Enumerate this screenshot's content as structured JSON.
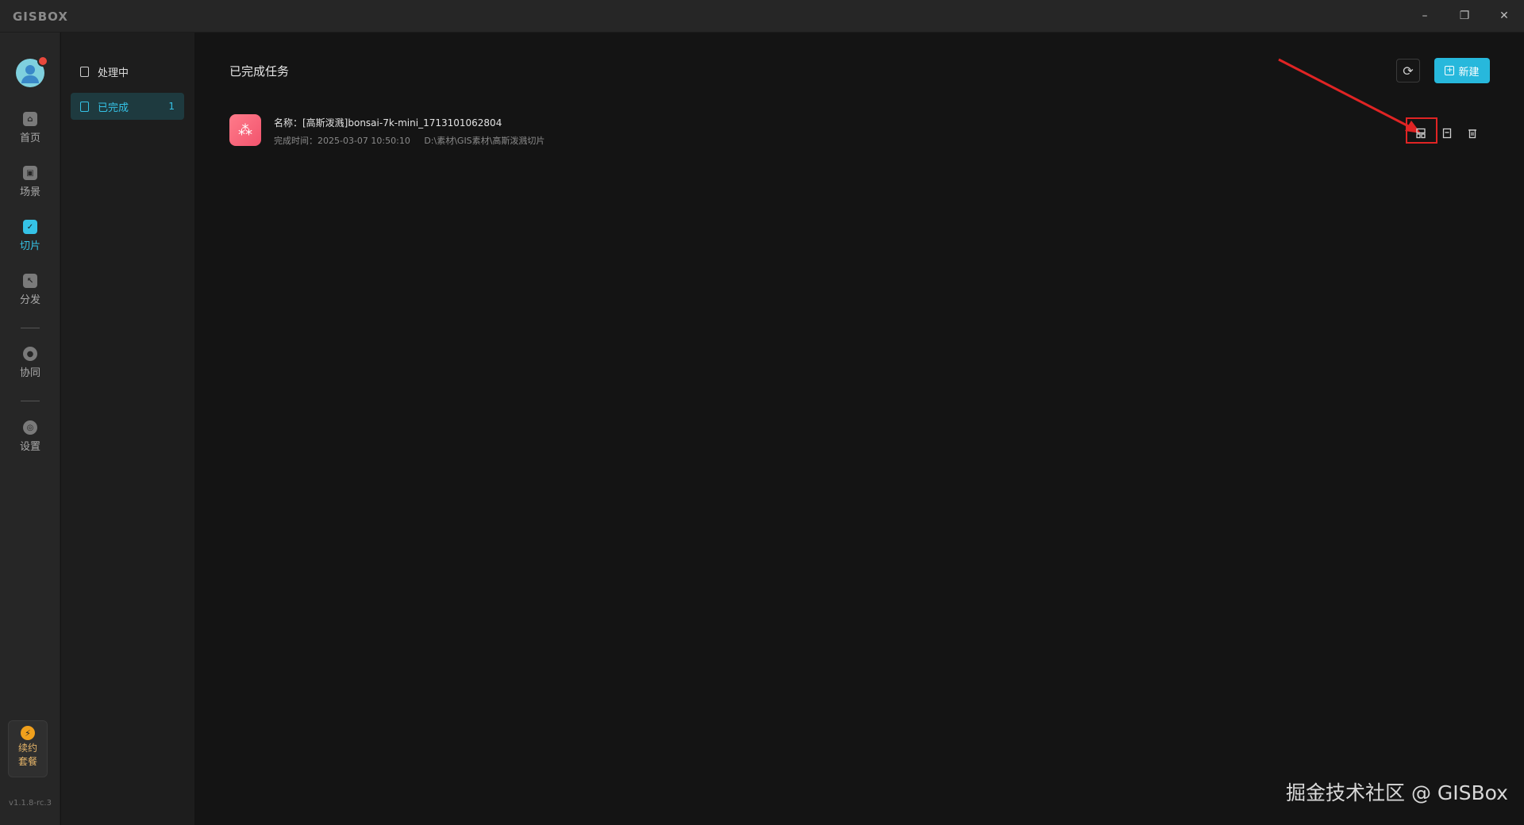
{
  "app": {
    "logo": "GISBOX"
  },
  "window_controls": {
    "minimize": "–",
    "maximize": "❐",
    "close": "✕"
  },
  "leftnav": {
    "items": [
      {
        "label": "首页",
        "icon": "home-icon"
      },
      {
        "label": "场景",
        "icon": "cube-icon"
      },
      {
        "label": "切片",
        "icon": "slice-icon",
        "active": true
      },
      {
        "label": "分发",
        "icon": "distribute-icon"
      },
      {
        "label": "协同",
        "icon": "lock-icon"
      },
      {
        "label": "设置",
        "icon": "gear-icon"
      }
    ],
    "promo_line1": "续约",
    "promo_line2": "套餐",
    "version": "v1.1.8-rc.3"
  },
  "subnav": {
    "items": [
      {
        "label": "处理中"
      },
      {
        "label": "已完成",
        "count": "1",
        "active": true
      }
    ]
  },
  "main": {
    "title": "已完成任务",
    "new_button": "新建",
    "task": {
      "name": "名称：[高斯泼溅]bonsai-7k-mini_1713101062804",
      "time": "完成时间：2025-03-07 10:50:10",
      "path": "D:\\素材\\GIS素材\\高斯泼溅切片"
    }
  },
  "watermark": "掘金技术社区 @ GISBox",
  "colors": {
    "accent": "#27b8dc",
    "highlight": "#e02424"
  }
}
